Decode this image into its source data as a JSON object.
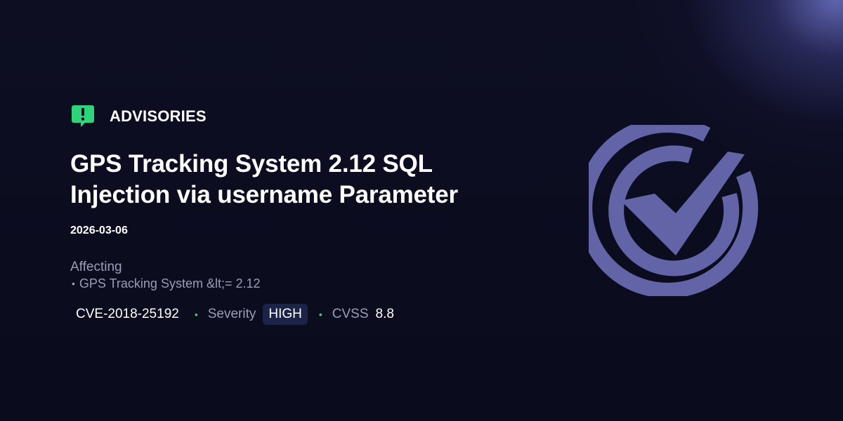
{
  "header": {
    "section_label": "ADVISORIES",
    "badge_icon": "exclamation-speech-bubble-icon",
    "badge_color": "#2ed47a"
  },
  "advisory": {
    "title": "GPS Tracking System 2.12 SQL Injection via username Parameter",
    "date": "2026-03-06",
    "affecting_label": "Affecting",
    "affected_items": [
      "GPS Tracking System &lt;= 2.12"
    ],
    "cve": "CVE-2018-25192",
    "severity_label": "Severity",
    "severity_value": "HIGH",
    "cvss_label": "CVSS",
    "cvss_value": "8.8"
  },
  "brand": {
    "logo_icon": "circle-checkmark-logo-icon",
    "logo_color": "#6264a7",
    "accent_color": "#2ed47a"
  }
}
